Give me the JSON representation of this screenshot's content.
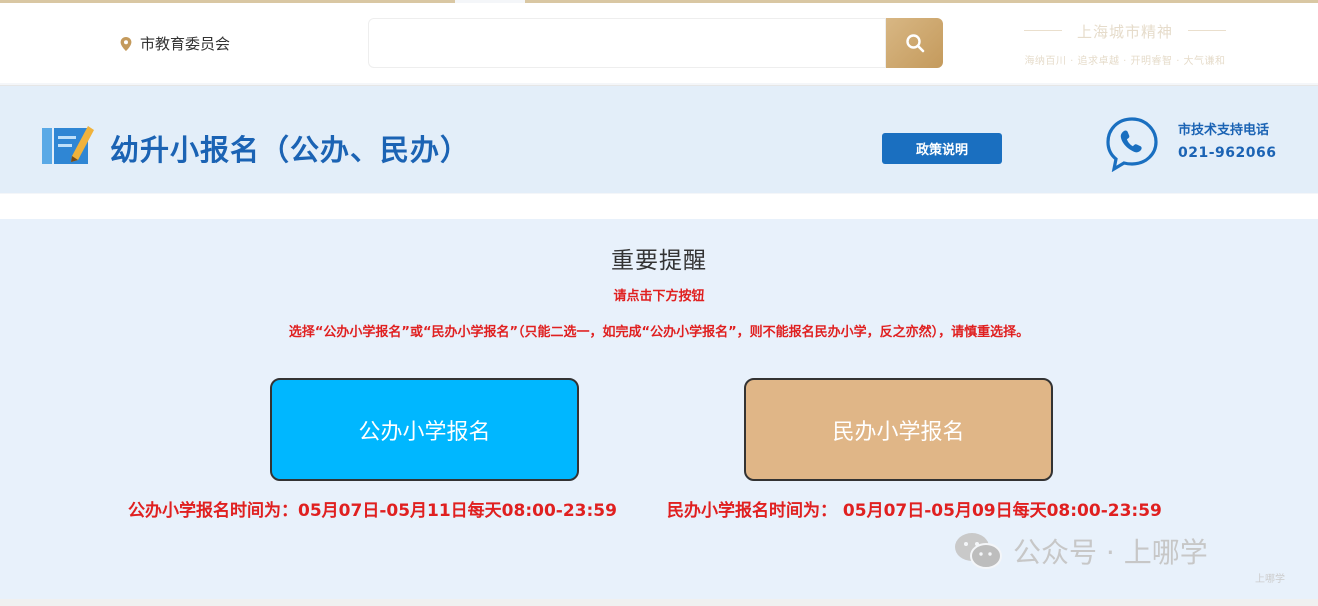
{
  "header": {
    "location": "市教育委员会",
    "search": {
      "value": "",
      "placeholder": ""
    },
    "spirit_title": "上海城市精神",
    "spirit_slogan": "海纳百川 · 追求卓越 · 开明睿智 · 大气谦和"
  },
  "title_band": {
    "page_title": "幼升小报名（公办、民办）",
    "policy_button": "政策说明",
    "support_label": "市技术支持电话",
    "support_phone": "021-962066"
  },
  "notice": {
    "title": "重要提醒",
    "subtitle": "请点击下方按钮",
    "body": "选择“公办小学报名”或“民办小学报名”（只能二选一，如完成“公办小学报名”，则不能报名民办小学，反之亦然），请慎重选择。"
  },
  "actions": {
    "public_button": "公办小学报名",
    "private_button": "民办小学报名",
    "public_time": "公办小学报名时间为：05月07日-05月11日每天08:00-23:59",
    "private_time": "民办小学报名时间为：  05月07日-05月09日每天08:00-23:59"
  },
  "watermark": {
    "text": "公众号 · 上哪学",
    "corner": "上哪学"
  },
  "colors": {
    "brand_blue": "#1b63b4",
    "public_button": "#00b7ff",
    "private_button": "#e0b687",
    "alert_red": "#e02020",
    "search_gold": "#c49a5c"
  },
  "icons": [
    "location-pin-icon",
    "search-icon",
    "form-edit-icon",
    "phone-icon",
    "wechat-icon"
  ]
}
